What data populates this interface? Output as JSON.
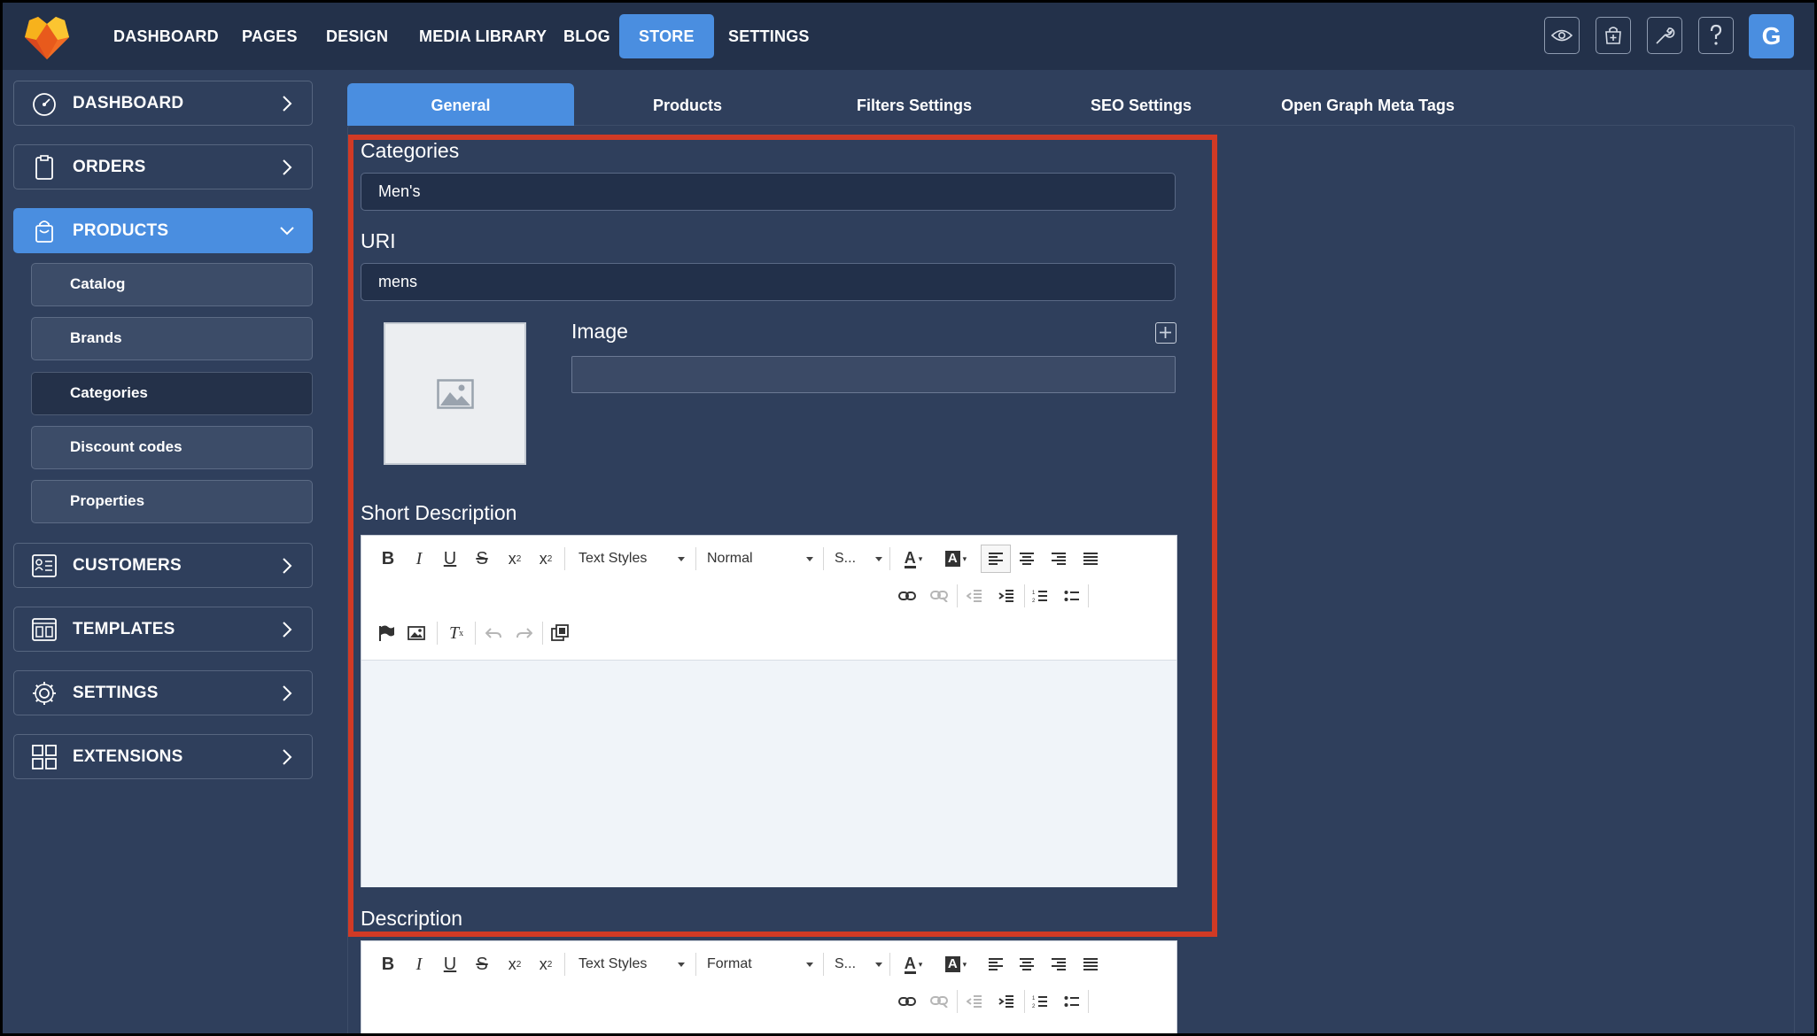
{
  "topnav": {
    "items": [
      "DASHBOARD",
      "PAGES",
      "DESIGN",
      "MEDIA LIBRARY",
      "BLOG",
      "STORE",
      "SETTINGS"
    ],
    "active": "STORE",
    "avatar_letter": "G",
    "tools": [
      "eye-icon",
      "add-to-cart-icon",
      "wrench-icon",
      "help-icon"
    ]
  },
  "sidebar": {
    "items": [
      {
        "label": "DASHBOARD",
        "icon": "gauge-icon"
      },
      {
        "label": "ORDERS",
        "icon": "clipboard-icon"
      },
      {
        "label": "PRODUCTS",
        "icon": "shopping-bag-icon",
        "expanded": true
      },
      {
        "label": "CUSTOMERS",
        "icon": "contact-card-icon"
      },
      {
        "label": "TEMPLATES",
        "icon": "template-icon"
      },
      {
        "label": "SETTINGS",
        "icon": "gear-icon"
      },
      {
        "label": "EXTENSIONS",
        "icon": "extensions-grid-icon"
      }
    ],
    "products_sub": [
      "Catalog",
      "Brands",
      "Categories",
      "Discount codes",
      "Properties"
    ],
    "selected_sub": "Categories"
  },
  "tabs": [
    "General",
    "Products",
    "Filters Settings",
    "SEO Settings",
    "Open Graph Meta Tags"
  ],
  "active_tab": "General",
  "form": {
    "categories_label": "Categories",
    "categories_value": "Men's",
    "uri_label": "URI",
    "uri_value": "mens",
    "image_label": "Image",
    "image_value": "",
    "short_description_label": "Short Description",
    "description_label": "Description"
  },
  "editor": {
    "text_styles": "Text Styles",
    "short_format": "Normal",
    "desc_format": "Format",
    "size": "S..."
  },
  "colors": {
    "accent": "#4a8ee0",
    "background": "#2f3f5c",
    "topbar": "#23314a",
    "highlight": "#d13a25"
  }
}
